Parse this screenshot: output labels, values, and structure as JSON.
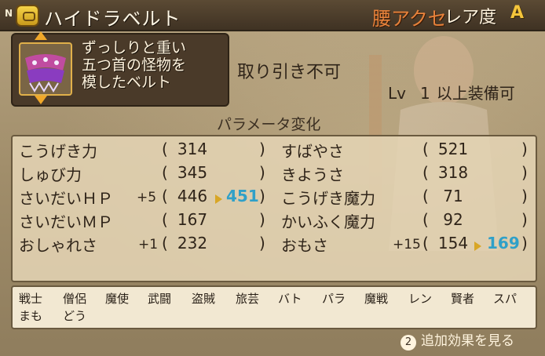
{
  "header": {
    "slot_badge": "N",
    "item_name": "ハイドラベルト",
    "category": "腰アクセ",
    "rarity_label": "レア度",
    "rarity_value": "A"
  },
  "description": [
    "ずっしりと重い",
    "五つ首の怪物を",
    "模したベルト"
  ],
  "trade_status": "取り引き不可",
  "level_req": {
    "prefix": "Lv",
    "level": "1",
    "suffix": "以上装備可"
  },
  "param_title": "パラメータ変化",
  "stats_left": [
    {
      "name": "こうげき力",
      "bonus": "",
      "value": "314",
      "new": ""
    },
    {
      "name": "しゅび力",
      "bonus": "",
      "value": "345",
      "new": ""
    },
    {
      "name": "さいだいＨＰ",
      "bonus": "+5",
      "value": "446",
      "new": "451"
    },
    {
      "name": "さいだいＭＰ",
      "bonus": "",
      "value": "167",
      "new": ""
    },
    {
      "name": "おしゃれさ",
      "bonus": "+1",
      "value": "232",
      "new": ""
    }
  ],
  "stats_right": [
    {
      "name": "すばやさ",
      "bonus": "",
      "value": "521",
      "new": ""
    },
    {
      "name": "きようさ",
      "bonus": "",
      "value": "318",
      "new": ""
    },
    {
      "name": "こうげき魔力",
      "bonus": "",
      "value": "71",
      "new": ""
    },
    {
      "name": "かいふく魔力",
      "bonus": "",
      "value": "92",
      "new": ""
    },
    {
      "name": "おもさ",
      "bonus": "+15",
      "value": "154",
      "new": "169"
    }
  ],
  "jobs_row1": [
    "戦士",
    "僧侶",
    "魔使",
    "武闘",
    "盗賊",
    "旅芸",
    "バト",
    "パラ",
    "魔戦",
    "レン",
    "賢者",
    "スパ"
  ],
  "jobs_row2": [
    "まも",
    "どう"
  ],
  "more_effects": {
    "button": "2",
    "label": "追加効果を見る"
  },
  "colors": {
    "accent_orange": "#e7823b",
    "rarity_gold": "#f5c53b",
    "new_value_blue": "#2fa0c8"
  }
}
